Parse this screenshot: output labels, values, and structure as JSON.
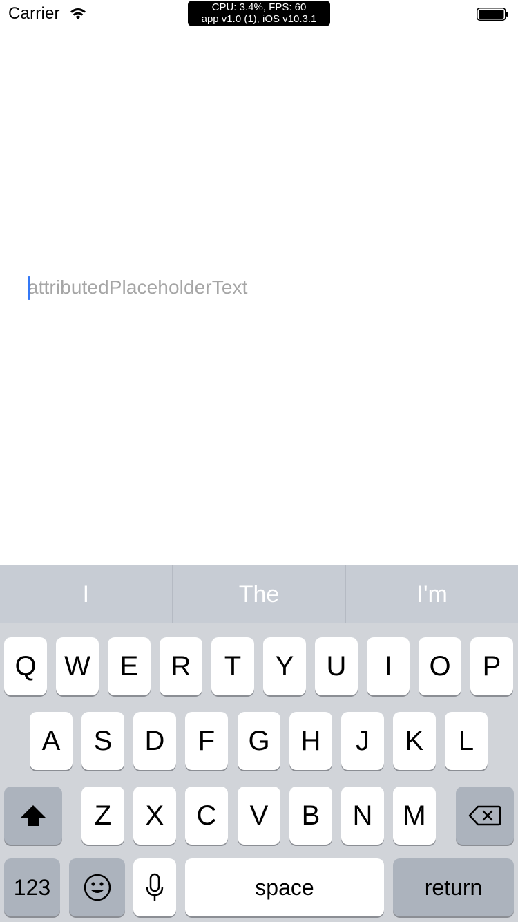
{
  "status_bar": {
    "carrier": "Carrier",
    "perf_line1": "CPU: 3.4%, FPS: 60",
    "perf_line2": "app v1.0 (1), iOS v10.3.1"
  },
  "text_field": {
    "placeholder": "attributedPlaceholderText",
    "cursor_color": "#3478f6"
  },
  "keyboard": {
    "suggestions": [
      "I",
      "The",
      "I'm"
    ],
    "row1": [
      "Q",
      "W",
      "E",
      "R",
      "T",
      "Y",
      "U",
      "I",
      "O",
      "P"
    ],
    "row2": [
      "A",
      "S",
      "D",
      "F",
      "G",
      "H",
      "J",
      "K",
      "L"
    ],
    "row3": [
      "Z",
      "X",
      "C",
      "V",
      "B",
      "N",
      "M"
    ],
    "numbers_label": "123",
    "space_label": "space",
    "return_label": "return",
    "icons": {
      "shift": "shift-icon",
      "delete": "delete-icon",
      "emoji": "emoji-icon",
      "mic": "microphone-icon"
    },
    "colors": {
      "background": "#d1d4d9",
      "key": "#ffffff",
      "special_key": "#acb3bd",
      "suggestion_bar": "#c7ccd4"
    }
  }
}
